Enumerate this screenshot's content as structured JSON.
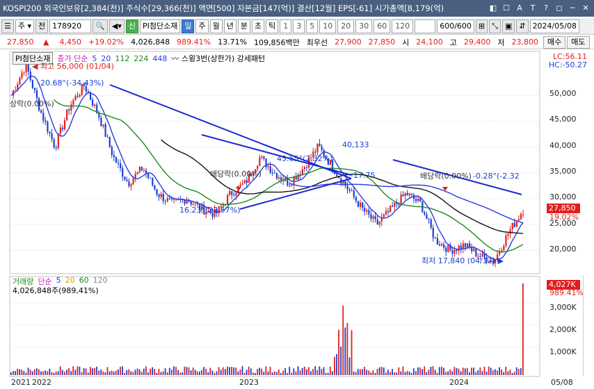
{
  "titlebar": {
    "text": "KOSPI200 외국인보유[2,384(천)] 주식수[29,366(천)] 액면[500] 자본금[147(억)] 결산[12월] EPS[-61] 시가총액[8,179(억)",
    "buttons": [
      "◧",
      "☐",
      "A",
      "T",
      "?",
      "◻",
      "─",
      "✕"
    ]
  },
  "toolbar": {
    "market": "주",
    "prev_label": "전",
    "code": "178920",
    "category_badge": "신",
    "stock_name": "PI첨단소재",
    "period_tabs": [
      "일",
      "주",
      "월",
      "년",
      "분",
      "초",
      "틱"
    ],
    "active_period": "일",
    "intervals": [
      "1",
      "3",
      "5",
      "10",
      "20",
      "30",
      "60",
      "120"
    ],
    "count_value": "600/600",
    "date_value": "2024/05/08"
  },
  "quote": {
    "price": "27,850",
    "arrow": "▲",
    "change": "4,450",
    "change_pct": "+19.02%",
    "volume": "4,026,848",
    "volume_ratio": "989.41%",
    "turnover": "13.71%",
    "amount": "109,856백만",
    "best_ask_label": "최우선",
    "best_ask": "27,900",
    "best_bid": "27,850",
    "low_label": "시",
    "open": "24,100",
    "high_label": "고",
    "high": "29,400",
    "low_label2": "저",
    "low": "23,800",
    "buy_label": "매수",
    "sell_label": "매도"
  },
  "legend": {
    "name": "PI첨단소재",
    "close_label": "종가 단순",
    "ma": [
      "5",
      "20",
      "112",
      "224",
      "448"
    ],
    "ma_colors": [
      "#3040d0",
      "#3040d0",
      "#1a8a1a",
      "#111111",
      "#2a3ae0"
    ],
    "extra": "스윙3번(상한가) 강세패턴"
  },
  "lc_hc": {
    "lc": "LC:56.11",
    "hc": "HC:-50.27"
  },
  "price_axis": [
    "50,000",
    "45,000",
    "40,000",
    "35,000",
    "30,000",
    "25,000",
    "20,000"
  ],
  "current_price_badge": "27,850",
  "current_pct": "19.02%",
  "annotations": {
    "high": "최고 56,000 (01/04)",
    "high_pct": "-20.68°(-34.43%)",
    "rise_left": "상락(0.00%)",
    "dividend1": "배당락(0.00%)",
    "low1": "16.23°(22.57%)",
    "mid_pct": "45.65°(7.32%)",
    "peak": "40,133",
    "pct_175": "-17.75",
    "dividend2": "배당락(0.00%)",
    "dividend2_b": "-0.28°(-2.32",
    "low": "최저 17,840 (04/17)"
  },
  "volume": {
    "legend_label": "거래량",
    "legend_type": "단순",
    "ma": [
      "5",
      "20",
      "60",
      "120"
    ],
    "ma_colors": [
      "#2040d0",
      "#e0a000",
      "#1a8a1a",
      "#888888"
    ],
    "info": "4,026,848주(989,41%)",
    "badge": "4,027K",
    "badge_pct": "989.41%",
    "axis": [
      "3,000K",
      "2,000K",
      "1,000K"
    ]
  },
  "xaxis": {
    "labels": [
      "2021",
      "2022",
      "2023",
      "2024",
      "05/08"
    ]
  },
  "colors": {
    "up": "#e0201e",
    "down": "#1a3fd0",
    "ma5": "#2a3ae0",
    "ma20": "#1a8a1a",
    "ma224": "#111111",
    "ma448": "#2a3ae0"
  },
  "chart_data": {
    "type": "line",
    "title": "PI첨단소재",
    "ylim": [
      16000,
      58000
    ],
    "series": [
      {
        "name": "종가",
        "values": [
          50000,
          56000,
          47000,
          40000,
          48000,
          52000,
          46000,
          38000,
          33000,
          36000,
          31000,
          29000,
          30000,
          28000,
          27000,
          31000,
          33000,
          38000,
          35000,
          33000,
          36000,
          40133,
          36000,
          32000,
          28000,
          25000,
          28000,
          31000,
          29000,
          22000,
          20000,
          21000,
          19000,
          17840,
          23400,
          27850
        ]
      }
    ],
    "grid": true
  }
}
